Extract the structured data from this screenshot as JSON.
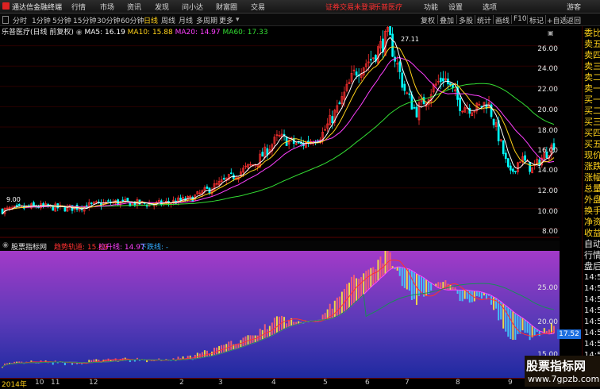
{
  "menubar": {
    "app_name": "通达信金融终端",
    "menus": [
      "行情",
      "市场",
      "资讯",
      "发现",
      "问小达",
      "财富圈",
      "交易"
    ],
    "notice": "证券交易未登录",
    "stock_name": "乐普医疗",
    "right": [
      "功能",
      "设置",
      "选项",
      "游客"
    ]
  },
  "toolbar": {
    "periods": [
      "分时",
      "1分钟",
      "5分钟",
      "15分钟",
      "30分钟",
      "60分钟",
      "日线",
      "周线",
      "月线",
      "多周期",
      "更多"
    ],
    "active_period": "日线",
    "right": [
      "复权",
      "叠加",
      "多股",
      "统计",
      "画线",
      "F10",
      "标记",
      "+自选",
      "返回"
    ]
  },
  "main_chart": {
    "header_title": "乐普医疗(日线 前复权)",
    "ma": [
      {
        "label": "MA5: 16.19",
        "color": "#ffffff"
      },
      {
        "label": "MA10: 15.88",
        "color": "#ffd11a"
      },
      {
        "label": "MA20: 14.97",
        "color": "#ff40ff"
      },
      {
        "label": "MA60: 17.33",
        "color": "#33dd33"
      }
    ],
    "high_label": "27.11",
    "low_label": "9.00",
    "y_ticks": [
      "26.00",
      "24.00",
      "22.00",
      "20.00",
      "18.00",
      "16.00",
      "14.00",
      "12.00",
      "10.00",
      "8.00"
    ]
  },
  "sub_chart": {
    "header_title": "股票指标网",
    "lines": [
      {
        "label": "趋势轨道: 15.69",
        "color": "#ff3030"
      },
      {
        "label": "拉升线: 14.97",
        "color": "#ff40ff"
      },
      {
        "label": "下跌线: -",
        "color": "#33aaff"
      }
    ],
    "y_ticks": [
      "25.00",
      "20.00",
      "15.00"
    ],
    "price_tag": "17.52"
  },
  "x_axis": {
    "labels": [
      "2014年",
      "10",
      "11",
      "12",
      "2",
      "3",
      "4",
      "5",
      "6",
      "7",
      "8",
      "9",
      "10"
    ]
  },
  "right_panel": {
    "items": [
      "委比",
      "卖五",
      "卖四",
      "卖三",
      "卖二",
      "卖一",
      "买一",
      "买二",
      "买三",
      "买四",
      "买五",
      "现价",
      "涨跌",
      "涨幅",
      "总量",
      "外盘",
      "换手",
      "净资",
      "收益",
      "自动",
      "行情",
      "盘后",
      "14:50",
      "14:50",
      "14:50",
      "14:50",
      "14:50",
      "14:50",
      "14:50",
      "14:50",
      "14:50"
    ]
  },
  "watermark": {
    "title": "股票指标网",
    "url": "www.7gpzb.com"
  },
  "colors": {
    "up": "#ff3030",
    "down": "#00ffff",
    "ma5": "#ffffff",
    "ma10": "#ffd11a",
    "ma20": "#ff40ff",
    "ma60": "#33dd33",
    "grid": "#5a0000"
  }
}
